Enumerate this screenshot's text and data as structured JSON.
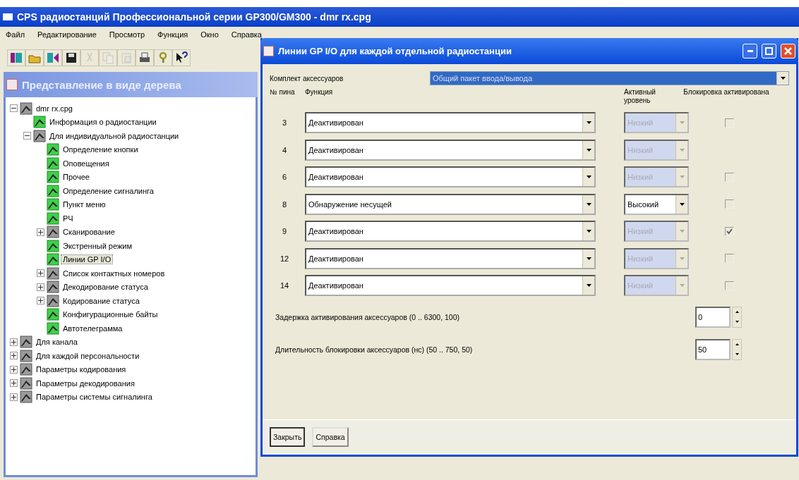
{
  "window": {
    "title": "CPS радиостанций Профессиональной серии GP300/GM300 - dmr rx.cpg"
  },
  "menu": [
    "Файл",
    "Редактирование",
    "Просмотр",
    "Функция",
    "Окно",
    "Справка"
  ],
  "toolbar": [
    {
      "kind": "read",
      "disabled": false
    },
    {
      "kind": "open",
      "disabled": false
    },
    {
      "kind": "write",
      "disabled": false
    },
    {
      "kind": "save",
      "disabled": false
    },
    {
      "kind": "cut",
      "disabled": true
    },
    {
      "kind": "copy",
      "disabled": true
    },
    {
      "kind": "paste",
      "disabled": true
    },
    {
      "kind": "print",
      "disabled": false
    },
    {
      "kind": "help",
      "disabled": false
    },
    {
      "kind": "context-help",
      "disabled": false
    }
  ],
  "tree_panel": {
    "title": "Представление в виде дерева",
    "items": [
      {
        "label": "dmr rx.cpg",
        "kind": "folder",
        "expanded": true,
        "selected": false,
        "children": [
          {
            "label": "Информация о радиостанции",
            "kind": "leaf",
            "selected": false
          },
          {
            "label": "Для индивидуальной радиостанции",
            "kind": "folder",
            "expanded": true,
            "selected": false,
            "children": [
              {
                "label": "Определение кнопки",
                "kind": "leaf",
                "selected": false
              },
              {
                "label": "Оповещения",
                "kind": "leaf",
                "selected": false
              },
              {
                "label": "Прочее",
                "kind": "leaf",
                "selected": false
              },
              {
                "label": "Определение сигналинга",
                "kind": "leaf",
                "selected": false
              },
              {
                "label": "Пункт меню",
                "kind": "leaf",
                "selected": false
              },
              {
                "label": "РЧ",
                "kind": "leaf",
                "selected": false
              },
              {
                "label": "Сканирование",
                "kind": "folder",
                "expanded": false,
                "selected": false
              },
              {
                "label": "Экстренный режим",
                "kind": "leaf",
                "selected": false
              },
              {
                "label": "Линии GP I/O",
                "kind": "leaf",
                "selected": true
              },
              {
                "label": "Список контактных номеров",
                "kind": "folder",
                "expanded": false,
                "selected": false
              },
              {
                "label": "Декодирование статуса",
                "kind": "folder",
                "expanded": false,
                "selected": false
              },
              {
                "label": "Кодирование статуса",
                "kind": "folder",
                "expanded": false,
                "selected": false
              },
              {
                "label": "Конфигурационные байты",
                "kind": "leaf",
                "selected": false
              },
              {
                "label": "Автотелеграмма",
                "kind": "leaf",
                "selected": false
              }
            ]
          }
        ]
      },
      {
        "label": "Для канала",
        "kind": "folder",
        "expanded": false,
        "selected": false
      },
      {
        "label": "Для каждой персональности",
        "kind": "folder",
        "expanded": false,
        "selected": false
      },
      {
        "label": "Параметры кодирования",
        "kind": "folder",
        "expanded": false,
        "selected": false
      },
      {
        "label": "Параметры декодирования",
        "kind": "folder",
        "expanded": false,
        "selected": false
      },
      {
        "label": "Параметры системы сигналинга",
        "kind": "folder",
        "expanded": false,
        "selected": false
      }
    ]
  },
  "dialog": {
    "title": "Линии GP I/O для каждой отдельной радиостанции",
    "kit_label": "Комплект аксессуаров",
    "kit_value": "Общий пакет ввода/вывода",
    "columns": [
      "№ пина",
      "Функция",
      "Активный уровень",
      "Блокировка активирована"
    ],
    "rows": [
      {
        "pin": "3",
        "function": "Деактивирован",
        "level": "Низкий",
        "level_disabled": true,
        "lock_checked": false
      },
      {
        "pin": "4",
        "function": "Деактивирован",
        "level": "Низкий",
        "level_disabled": true
      },
      {
        "pin": "6",
        "function": "Деактивирован",
        "level": "Низкий",
        "level_disabled": true,
        "lock_checked": false
      },
      {
        "pin": "8",
        "function": "Обнаружение несущей",
        "level": "Высокий",
        "level_disabled": false,
        "lock_checked": false
      },
      {
        "pin": "9",
        "function": "Деактивирован",
        "level": "Низкий",
        "level_disabled": true,
        "lock_checked": true
      },
      {
        "pin": "12",
        "function": "Деактивирован",
        "level": "Низкий",
        "level_disabled": true,
        "lock_checked": false
      },
      {
        "pin": "14",
        "function": "Деактивирован",
        "level": "Низкий",
        "level_disabled": true,
        "lock_checked": false
      }
    ],
    "spinners": [
      {
        "label": "Задержка активирования аксессуаров (0 .. 6300, 100)",
        "value": "0"
      },
      {
        "label": "Длительность блокировки аксессуаров (нс) (50 .. 750, 50)",
        "value": "50"
      }
    ],
    "buttons": [
      "Закрыть",
      "Справка"
    ]
  }
}
